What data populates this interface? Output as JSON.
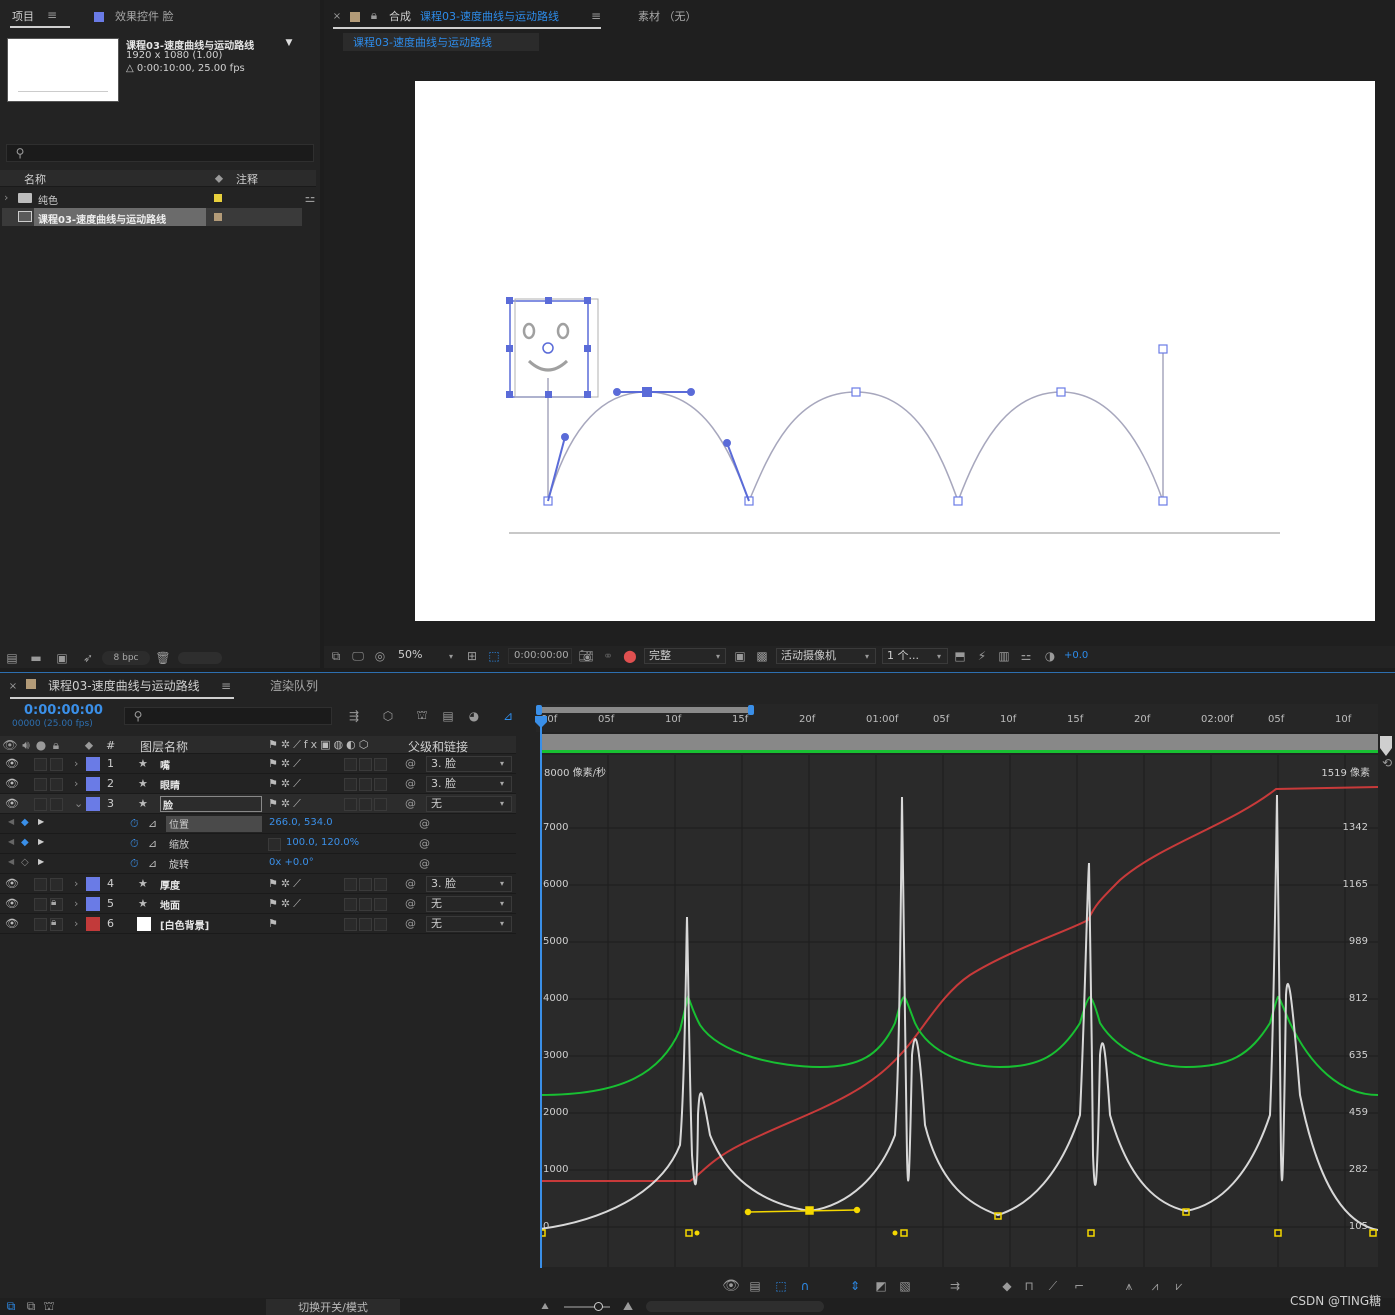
{
  "project_panel": {
    "tab_project": "项目",
    "tab_effects": "效果控件 脸",
    "comp_name": "课程03-速度曲线与运动路线",
    "comp_dims": "1920 x 1080 (1.00)",
    "comp_duration": "△ 0:00:10:00, 25.00 fps",
    "search_placeholder": "",
    "col_name": "名称",
    "col_comment": "注释",
    "items": [
      {
        "name": "纯色",
        "type": "folder",
        "label_color": "#e8d03c"
      },
      {
        "name": "课程03-速度曲线与运动路线",
        "type": "comp",
        "label_color": "#b39b78"
      }
    ],
    "bpc": "8 bpc"
  },
  "comp_viewer": {
    "tab_prefix": "合成",
    "tab_comp": "课程03-速度曲线与运动路线",
    "tab_footage": "素材 （无）",
    "sub_tab": "课程03-速度曲线与运动路线",
    "zoom": "50%",
    "timecode": "0:00:00:00",
    "resolution": "完整",
    "camera": "活动摄像机",
    "views": "1 个...",
    "exposure": "+0.0"
  },
  "timeline": {
    "tab_comp": "课程03-速度曲线与运动路线",
    "tab_render": "渲染队列",
    "timecode": "0:00:00:00",
    "frame_info": "00000 (25.00 fps)",
    "col_num": "#",
    "col_layer_name": "图层名称",
    "col_parent": "父级和链接",
    "layers": [
      {
        "num": "1",
        "name": "嘴",
        "color": "#6a7be6",
        "parent": "3. 脸"
      },
      {
        "num": "2",
        "name": "眼睛",
        "color": "#6a7be6",
        "parent": "3. 脸"
      },
      {
        "num": "3",
        "name": "脸",
        "color": "#6a7be6",
        "parent": "无"
      },
      {
        "num": "4",
        "name": "厚度",
        "color": "#6a7be6",
        "parent": "3. 脸"
      },
      {
        "num": "5",
        "name": "地面",
        "color": "#6a7be6",
        "parent": "无"
      },
      {
        "num": "6",
        "name": "[白色背景]",
        "color": "#c23a3a",
        "parent": "无"
      }
    ],
    "properties": [
      {
        "name": "位置",
        "value": "266.0, 534.0"
      },
      {
        "name": "缩放",
        "value": "100.0, 120.0%"
      },
      {
        "name": "旋转",
        "value": "0x +0.0°"
      }
    ],
    "ruler_ticks": [
      "00f",
      "05f",
      "10f",
      "15f",
      "20f",
      "01:00f",
      "05f",
      "10f",
      "15f",
      "20f",
      "02:00f",
      "05f",
      "10f"
    ],
    "toggle_label": "切换开关/模式"
  },
  "graph_editor": {
    "left_unit": "8000 像素/秒",
    "right_unit": "1519 像素",
    "left_ticks": [
      "7000",
      "6000",
      "5000",
      "4000",
      "3000",
      "2000",
      "1000",
      "0"
    ],
    "right_ticks": [
      "1342",
      "1165",
      "989",
      "812",
      "635",
      "459",
      "282",
      "105"
    ]
  },
  "watermark": "CSDN @TING糖",
  "colors": {
    "accent": "#2d8ceb",
    "layer_label": "#6a7be6",
    "red_curve": "#c83a3a",
    "green_curve": "#18c032",
    "keyframe": "#f5d800"
  }
}
